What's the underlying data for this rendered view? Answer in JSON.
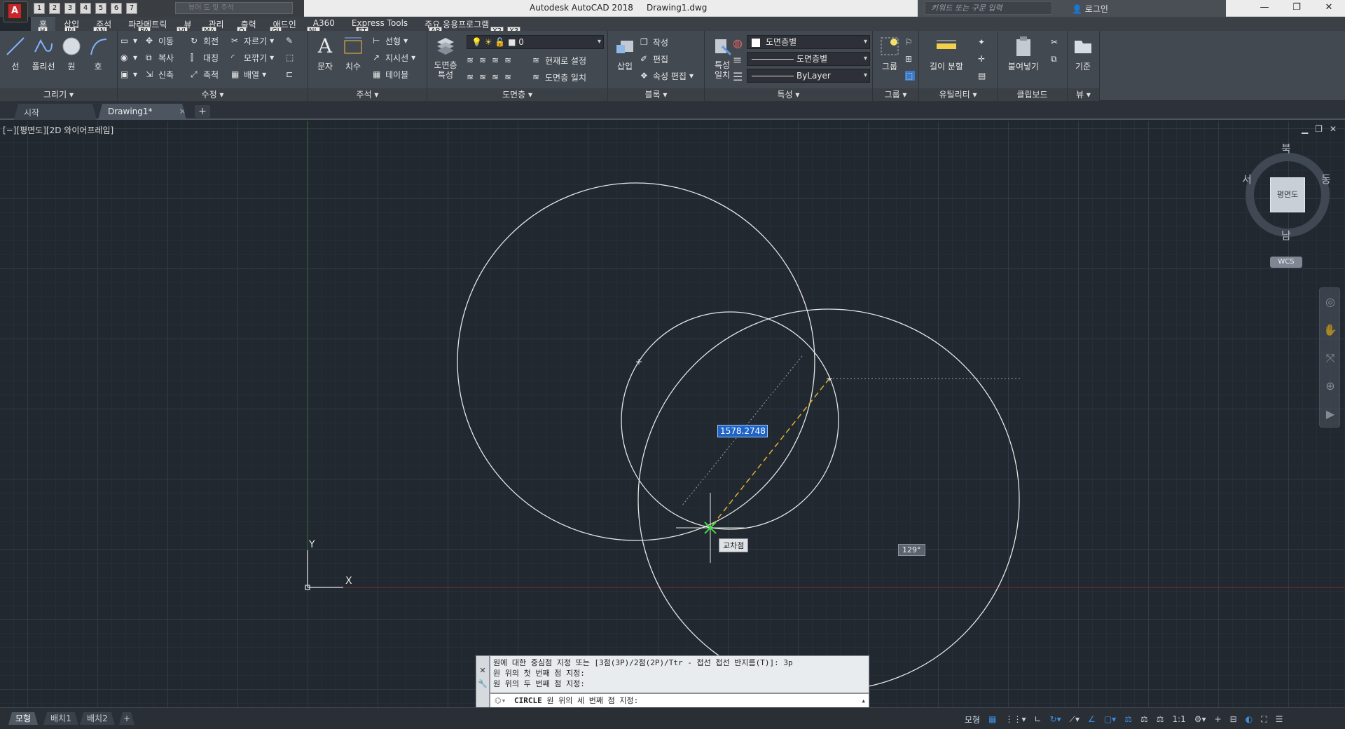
{
  "title_bar": {
    "app_title": "Autodesk AutoCAD 2018     Drawing1.dwg",
    "search_placeholder": "키워드 또는 구문 입력",
    "qat_search": "뷰어 도 및 주석",
    "login": "로그인",
    "qat_keys": [
      "1",
      "2",
      "3",
      "4",
      "5",
      "6",
      "7"
    ]
  },
  "menu": {
    "tabs": [
      "홈",
      "삽입",
      "주석",
      "파라메트릭",
      "뷰",
      "관리",
      "출력",
      "애드인",
      "A360",
      "Express Tools",
      "주요 응용프로그램"
    ],
    "active": "홈"
  },
  "keytips": {
    "home": "H",
    "insert": "IN",
    "annotate": "AN",
    "parametric": "PA",
    "view": "VI",
    "manage": "MA",
    "output": "O",
    "addin": "GI",
    "a360": "NL",
    "express": "ET",
    "apps": "AP",
    "x2": "X2",
    "x3": "X3"
  },
  "ribbon": {
    "draw": {
      "title": "그리기 ▾",
      "line": "선",
      "polyline": "폴리선",
      "circle": "원",
      "arc": "호"
    },
    "modify": {
      "title": "수정 ▾",
      "move": "이동",
      "rotate": "회전",
      "trim": "자르기",
      "copy": "복사",
      "mirror": "대칭",
      "fillet": "모깎기",
      "stretch": "신축",
      "scale": "축척",
      "array": "배열"
    },
    "annotation": {
      "title": "주석 ▾",
      "text": "문자",
      "dimension": "치수",
      "linear": "선형",
      "leader": "지시선",
      "table": "테이블"
    },
    "layers": {
      "title": "도면층 ▾",
      "properties": "도면층\n특성",
      "current_layer": "0",
      "set_current": "현재로 설정",
      "match": "도면층 일치"
    },
    "block": {
      "title": "블록 ▾",
      "insert": "삽입",
      "create": "작성",
      "edit": "편집",
      "attr_edit": "속성 편집"
    },
    "properties": {
      "title": "특성 ▾",
      "match": "특성\n일치",
      "color": "도면층별",
      "linetype": "도면층별",
      "lineweight": "ByLayer"
    },
    "groups": {
      "title": "그룹 ▾",
      "group": "그룹"
    },
    "utilities": {
      "title": "유틸리티 ▾",
      "measure": "길이 분할"
    },
    "clipboard": {
      "title": "클립보드",
      "paste": "붙여넣기"
    },
    "view": {
      "title": "뷰 ▾",
      "base": "기준"
    }
  },
  "file_tabs": {
    "start": "시작",
    "drawing": "Drawing1*"
  },
  "viewport": {
    "label": "[−][평면도][2D 와이어프레임]",
    "dynamic_input": "1578.2748",
    "osnap_tip": "교차점",
    "angle_tip": "129°"
  },
  "viewcube": {
    "north": "북",
    "south": "남",
    "east": "동",
    "west": "서",
    "face": "평면도",
    "wcs": "WCS"
  },
  "ucs": {
    "x": "X",
    "y": "Y"
  },
  "command": {
    "history": [
      "원에 대한 중심점 지정 또는 [3점(3P)/2점(2P)/Ttr - 접선 접선 반지름(T)]: 3p",
      "원 위의 첫 번째 점 지정:",
      "원 위의 두 번째 점 지정:"
    ],
    "current_cmd": "CIRCLE",
    "prompt": " 원 위의 세 번째 점 지정:"
  },
  "layout_tabs": [
    "모형",
    "배치1",
    "배치2"
  ],
  "status": {
    "model": "모형",
    "scale": "1:1"
  },
  "colors": {
    "canvas": "#212830",
    "accent": "#1e64c8",
    "xaxis": "#7a2a2a",
    "yaxis": "#2a6a2a"
  }
}
